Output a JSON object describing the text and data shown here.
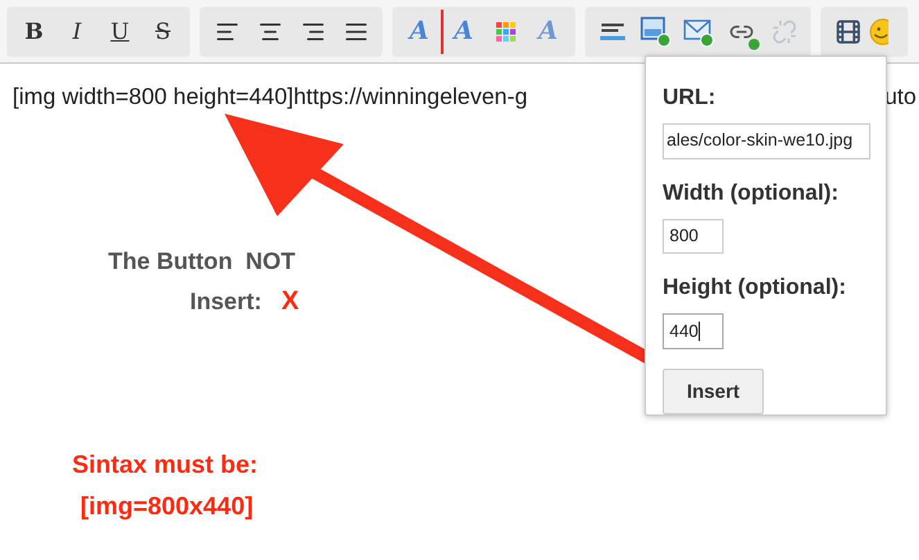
{
  "toolbar": {
    "groups": [
      {
        "buttons": [
          {
            "kind": "bold",
            "label": "B"
          },
          {
            "kind": "italic",
            "label": "I"
          },
          {
            "kind": "underline",
            "label": "U"
          },
          {
            "kind": "strike",
            "label": "S"
          }
        ]
      },
      {
        "buttons": [
          {
            "kind": "align-left"
          },
          {
            "kind": "align-center"
          },
          {
            "kind": "align-right"
          },
          {
            "kind": "justify"
          }
        ]
      },
      {
        "buttons": [
          {
            "kind": "font",
            "label": "A"
          },
          {
            "kind": "size",
            "label": "A"
          },
          {
            "kind": "color"
          },
          {
            "kind": "remove-format",
            "label": "A"
          }
        ]
      },
      {
        "buttons": [
          {
            "kind": "rule"
          },
          {
            "kind": "image"
          },
          {
            "kind": "email"
          },
          {
            "kind": "link"
          },
          {
            "kind": "unlink"
          }
        ]
      },
      {
        "buttons": [
          {
            "kind": "media"
          },
          {
            "kind": "smiley"
          }
        ]
      }
    ]
  },
  "editor": {
    "text": "[img width=800 height=440]https://winningeleven-g",
    "text_tail": "uto"
  },
  "popup": {
    "url_label": "URL:",
    "url_value": "ales/color-skin-we10.jpg",
    "width_label": "Width (optional):",
    "width_value": "800",
    "height_label": "Height (optional):",
    "height_value": "440",
    "button": "Insert"
  },
  "annotations": {
    "line_1": "The Button  NOT",
    "line_2": "Insert:",
    "mark": "X",
    "syntax_label": "Sintax must be:",
    "syntax_value": "[img=800x440]"
  }
}
